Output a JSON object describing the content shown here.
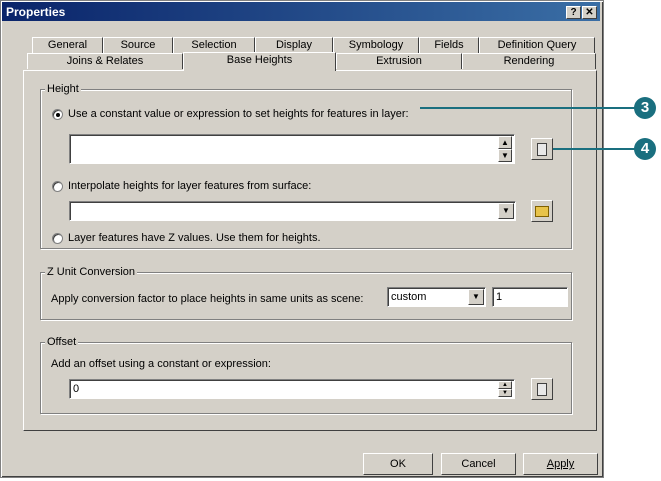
{
  "window": {
    "title": "Properties",
    "help_button": "?",
    "close_button": "✕"
  },
  "tabs_row1": [
    "General",
    "Source",
    "Selection",
    "Display",
    "Symbology",
    "Fields",
    "Definition Query"
  ],
  "tabs_row2": [
    "Joins & Relates",
    "Base Heights",
    "Extrusion",
    "Rendering"
  ],
  "active_tab": "Base Heights",
  "height_group": {
    "legend": "Height",
    "option_constant": "Use a constant value or expression to set heights for features in layer:",
    "constant_value": "",
    "option_surface": "Interpolate heights for layer features from surface:",
    "surface_value": "",
    "option_z": "Layer features have Z values.  Use them for heights.",
    "selected": "constant"
  },
  "z_unit_group": {
    "legend": "Z Unit Conversion",
    "label": "Apply conversion factor to place heights in same units as scene:",
    "unit_value": "custom",
    "factor_value": "1"
  },
  "offset_group": {
    "legend": "Offset",
    "label": "Add an offset using a constant or expression:",
    "offset_value": "0"
  },
  "buttons": {
    "ok": "OK",
    "cancel": "Cancel",
    "apply": "Apply"
  },
  "callouts": [
    "3",
    "4"
  ],
  "colors": {
    "titlebar": "#0a246a",
    "dialog": "#d4d0c8",
    "callout": "#1a6f7f"
  }
}
